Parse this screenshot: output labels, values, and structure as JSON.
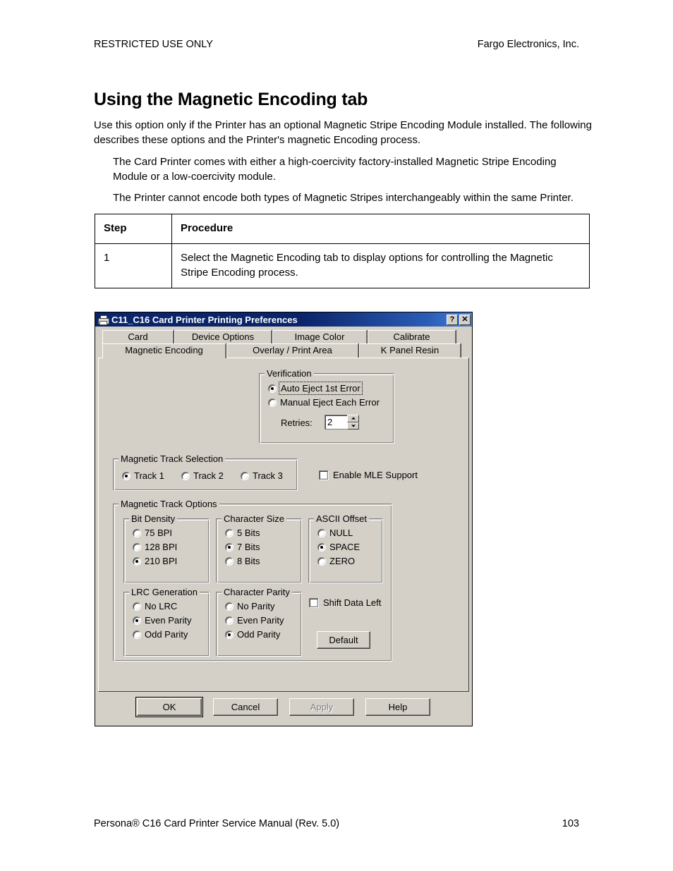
{
  "page": {
    "header_left": "RESTRICTED USE ONLY",
    "header_right": "Fargo Electronics, Inc.",
    "title": "Using the Magnetic Encoding tab",
    "intro": "Use this option only if the Printer has an optional Magnetic Stripe Encoding Module installed. The following describes these options and the Printer's magnetic Encoding process.",
    "note_1": "The Card Printer comes with either a high-coercivity factory-installed Magnetic Stripe Encoding Module or a low-coercivity module.",
    "note_2": "The Printer cannot encode both types of Magnetic Stripes interchangeably within the same Printer.",
    "footer_left": "Persona® C16 Card Printer Service Manual (Rev. 5.0)",
    "footer_right": "103"
  },
  "procedure_table": {
    "headers": [
      "Step",
      "Procedure"
    ],
    "rows": [
      {
        "step": "1",
        "procedure": "Select the Magnetic Encoding tab to display options for controlling the Magnetic Stripe Encoding process."
      }
    ]
  },
  "dialog": {
    "title": "C11_C16 Card Printer Printing Preferences",
    "icon": "printer-icon",
    "title_buttons": [
      {
        "name": "help",
        "glyph": "?"
      },
      {
        "name": "close",
        "glyph": "✕"
      }
    ],
    "tabs_row1": [
      {
        "label": "Card",
        "active": false
      },
      {
        "label": "Device Options",
        "active": false
      },
      {
        "label": "Image Color",
        "active": false
      },
      {
        "label": "Calibrate",
        "active": false
      }
    ],
    "tabs_row2": [
      {
        "label": "Magnetic Encoding",
        "active": true
      },
      {
        "label": "Overlay / Print Area",
        "active": false
      },
      {
        "label": "K Panel Resin",
        "active": false
      }
    ],
    "verification": {
      "title": "Verification",
      "options": [
        {
          "label": "Auto Eject 1st Error",
          "selected": true,
          "focused": true
        },
        {
          "label": "Manual Eject Each Error",
          "selected": false,
          "focused": false
        }
      ],
      "retries_label": "Retries:",
      "retries_value": "2"
    },
    "track_selection": {
      "title": "Magnetic Track Selection",
      "options": [
        {
          "label": "Track 1",
          "selected": true
        },
        {
          "label": "Track 2",
          "selected": false
        },
        {
          "label": "Track 3",
          "selected": false
        }
      ]
    },
    "enable_mle": {
      "label": "Enable MLE Support",
      "checked": false
    },
    "track_options": {
      "title": "Magnetic Track Options",
      "bit_density": {
        "title": "Bit Density",
        "options": [
          {
            "label": "75 BPI",
            "selected": false
          },
          {
            "label": "128 BPI",
            "selected": false
          },
          {
            "label": "210 BPI",
            "selected": true
          }
        ]
      },
      "character_size": {
        "title": "Character Size",
        "options": [
          {
            "label": "5 Bits",
            "selected": false
          },
          {
            "label": "7 Bits",
            "selected": true
          },
          {
            "label": "8 Bits",
            "selected": false
          }
        ]
      },
      "ascii_offset": {
        "title": "ASCII Offset",
        "options": [
          {
            "label": "NULL",
            "selected": false
          },
          {
            "label": "SPACE",
            "selected": true
          },
          {
            "label": "ZERO",
            "selected": false
          }
        ]
      },
      "lrc_generation": {
        "title": "LRC Generation",
        "options": [
          {
            "label": "No LRC",
            "selected": false
          },
          {
            "label": "Even Parity",
            "selected": true
          },
          {
            "label": "Odd Parity",
            "selected": false
          }
        ]
      },
      "character_parity": {
        "title": "Character Parity",
        "options": [
          {
            "label": "No Parity",
            "selected": false
          },
          {
            "label": "Even Parity",
            "selected": false
          },
          {
            "label": "Odd Parity",
            "selected": true
          }
        ]
      },
      "shift_data_left": {
        "label": "Shift Data Left",
        "checked": false
      },
      "default_button": "Default"
    },
    "buttons": [
      {
        "label": "OK",
        "default": true,
        "enabled": true
      },
      {
        "label": "Cancel",
        "default": false,
        "enabled": true
      },
      {
        "label": "Apply",
        "default": false,
        "enabled": false
      },
      {
        "label": "Help",
        "default": false,
        "enabled": true
      }
    ]
  },
  "colors": {
    "dialog_face": "#d4d0c8",
    "titlebar_start": "#0a246a",
    "titlebar_end": "#4a80d8",
    "titlebar_text": "#ffffff"
  }
}
